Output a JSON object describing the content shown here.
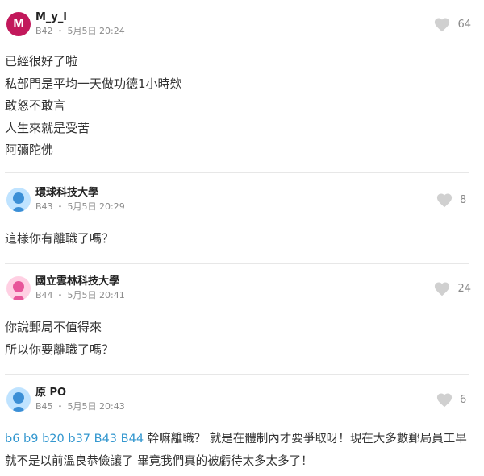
{
  "comments": [
    {
      "author": "M_y_l",
      "avatar_letter": "M",
      "floor": "B42",
      "time": "5月5日 20:24",
      "likes": "64",
      "lines": [
        "已經很好了啦",
        "私部門是平均一天做功德1小時欸",
        "敢怒不敢言",
        "人生來就是受苦",
        "阿彌陀佛"
      ]
    },
    {
      "author": "環球科技大學",
      "floor": "B43",
      "time": "5月5日 20:29",
      "likes": "8",
      "lines": [
        "這樣你有離職了嗎？"
      ]
    },
    {
      "author": "國立雲林科技大學",
      "floor": "B44",
      "time": "5月5日 20:41",
      "likes": "24",
      "lines": [
        "你說郵局不值得來",
        "所以你要離職了嗎？"
      ]
    },
    {
      "author": "原 PO",
      "floor": "B45",
      "time": "5月5日 20:43",
      "likes": "6",
      "tags": [
        "b6",
        "b9",
        "b20",
        "b37",
        "B43",
        "B44"
      ],
      "text_after_tags": "幹嘛離職？ 就是在體制內才要爭取呀！現在大多數郵局員工早",
      "line2": "就不是以前溫良恭儉讓了 畢竟我們真的被虧待太多太多了！"
    }
  ],
  "separator": "・",
  "colors": {
    "link": "#3397cf",
    "avatar_m": "#c2185b",
    "like_icon": "#d0d0d0"
  }
}
